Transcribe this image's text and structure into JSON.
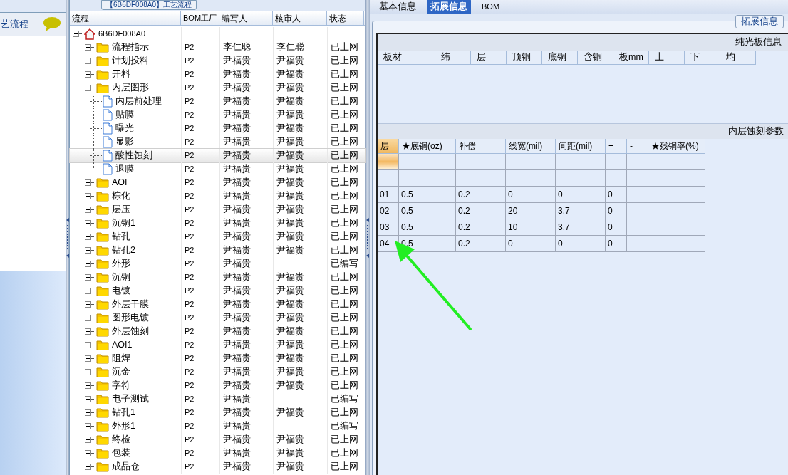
{
  "sidebar": {
    "title": "艺流程"
  },
  "process_panel": {
    "title": "【6B6DF008A0】工艺流程",
    "columns": [
      "流程",
      "BOM工厂",
      "编写人",
      "核审人",
      "状态"
    ],
    "tree": {
      "label": "6B6DF008A0",
      "kind": "root",
      "expanded": true,
      "selected": false,
      "children": [
        {
          "label": "流程指示",
          "kind": "folder",
          "expanded": false,
          "selected": false,
          "factory": "P2",
          "writer": "李仁聪",
          "reviewer": "李仁聪",
          "status": "已上网"
        },
        {
          "label": "计划投料",
          "kind": "folder",
          "expanded": false,
          "selected": false,
          "factory": "P2",
          "writer": "尹福贵",
          "reviewer": "尹福贵",
          "status": "已上网"
        },
        {
          "label": "开料",
          "kind": "folder",
          "expanded": false,
          "selected": false,
          "factory": "P2",
          "writer": "尹福贵",
          "reviewer": "尹福贵",
          "status": "已上网"
        },
        {
          "label": "内层图形",
          "kind": "folder",
          "expanded": true,
          "selected": false,
          "factory": "P2",
          "writer": "尹福贵",
          "reviewer": "尹福贵",
          "status": "已上网",
          "children": [
            {
              "label": "内层前处理",
              "kind": "document",
              "selected": false,
              "factory": "P2",
              "writer": "尹福贵",
              "reviewer": "尹福贵",
              "status": "已上网"
            },
            {
              "label": "贴膜",
              "kind": "document",
              "selected": false,
              "factory": "P2",
              "writer": "尹福贵",
              "reviewer": "尹福贵",
              "status": "已上网"
            },
            {
              "label": "曝光",
              "kind": "document",
              "selected": false,
              "factory": "P2",
              "writer": "尹福贵",
              "reviewer": "尹福贵",
              "status": "已上网"
            },
            {
              "label": "显影",
              "kind": "document",
              "selected": false,
              "factory": "P2",
              "writer": "尹福贵",
              "reviewer": "尹福贵",
              "status": "已上网"
            },
            {
              "label": "酸性蚀刻",
              "kind": "document",
              "selected": true,
              "factory": "P2",
              "writer": "尹福贵",
              "reviewer": "尹福贵",
              "status": "已上网"
            },
            {
              "label": "退膜",
              "kind": "document",
              "selected": false,
              "factory": "P2",
              "writer": "尹福贵",
              "reviewer": "尹福贵",
              "status": "已上网"
            }
          ]
        },
        {
          "label": "AOI",
          "kind": "folder",
          "expanded": false,
          "selected": false,
          "factory": "P2",
          "writer": "尹福贵",
          "reviewer": "尹福贵",
          "status": "已上网"
        },
        {
          "label": "棕化",
          "kind": "folder",
          "expanded": false,
          "selected": false,
          "factory": "P2",
          "writer": "尹福贵",
          "reviewer": "尹福贵",
          "status": "已上网"
        },
        {
          "label": "层压",
          "kind": "folder",
          "expanded": false,
          "selected": false,
          "factory": "P2",
          "writer": "尹福贵",
          "reviewer": "尹福贵",
          "status": "已上网"
        },
        {
          "label": "沉铜1",
          "kind": "folder",
          "expanded": false,
          "selected": false,
          "factory": "P2",
          "writer": "尹福贵",
          "reviewer": "尹福贵",
          "status": "已上网"
        },
        {
          "label": "钻孔",
          "kind": "folder",
          "expanded": false,
          "selected": false,
          "factory": "P2",
          "writer": "尹福贵",
          "reviewer": "尹福贵",
          "status": "已上网"
        },
        {
          "label": "钻孔2",
          "kind": "folder",
          "expanded": false,
          "selected": false,
          "factory": "P2",
          "writer": "尹福贵",
          "reviewer": "尹福贵",
          "status": "已上网"
        },
        {
          "label": "外形",
          "kind": "folder",
          "expanded": false,
          "selected": false,
          "factory": "P2",
          "writer": "尹福贵",
          "status": "已编写"
        },
        {
          "label": "沉铜",
          "kind": "folder",
          "expanded": false,
          "selected": false,
          "factory": "P2",
          "writer": "尹福贵",
          "reviewer": "尹福贵",
          "status": "已上网"
        },
        {
          "label": "电镀",
          "kind": "folder",
          "expanded": false,
          "selected": false,
          "factory": "P2",
          "writer": "尹福贵",
          "reviewer": "尹福贵",
          "status": "已上网"
        },
        {
          "label": "外层干膜",
          "kind": "folder",
          "expanded": false,
          "selected": false,
          "factory": "P2",
          "writer": "尹福贵",
          "reviewer": "尹福贵",
          "status": "已上网"
        },
        {
          "label": "图形电镀",
          "kind": "folder",
          "expanded": false,
          "selected": false,
          "factory": "P2",
          "writer": "尹福贵",
          "reviewer": "尹福贵",
          "status": "已上网"
        },
        {
          "label": "外层蚀刻",
          "kind": "folder",
          "expanded": false,
          "selected": false,
          "factory": "P2",
          "writer": "尹福贵",
          "reviewer": "尹福贵",
          "status": "已上网"
        },
        {
          "label": "AOI1",
          "kind": "folder",
          "expanded": false,
          "selected": false,
          "factory": "P2",
          "writer": "尹福贵",
          "reviewer": "尹福贵",
          "status": "已上网"
        },
        {
          "label": "阻焊",
          "kind": "folder",
          "expanded": false,
          "selected": false,
          "factory": "P2",
          "writer": "尹福贵",
          "reviewer": "尹福贵",
          "status": "已上网"
        },
        {
          "label": "沉金",
          "kind": "folder",
          "expanded": false,
          "selected": false,
          "factory": "P2",
          "writer": "尹福贵",
          "reviewer": "尹福贵",
          "status": "已上网"
        },
        {
          "label": "字符",
          "kind": "folder",
          "expanded": false,
          "selected": false,
          "factory": "P2",
          "writer": "尹福贵",
          "reviewer": "尹福贵",
          "status": "已上网"
        },
        {
          "label": "电子测试",
          "kind": "folder",
          "expanded": false,
          "selected": false,
          "factory": "P2",
          "writer": "尹福贵",
          "status": "已编写"
        },
        {
          "label": "钻孔1",
          "kind": "folder",
          "expanded": false,
          "selected": false,
          "factory": "P2",
          "writer": "尹福贵",
          "reviewer": "尹福贵",
          "status": "已上网"
        },
        {
          "label": "外形1",
          "kind": "folder",
          "expanded": false,
          "selected": false,
          "factory": "P2",
          "writer": "尹福贵",
          "status": "已编写"
        },
        {
          "label": "终检",
          "kind": "folder",
          "expanded": false,
          "selected": false,
          "factory": "P2",
          "writer": "尹福贵",
          "reviewer": "尹福贵",
          "status": "已上网"
        },
        {
          "label": "包装",
          "kind": "folder",
          "expanded": false,
          "selected": false,
          "factory": "P2",
          "writer": "尹福贵",
          "reviewer": "尹福贵",
          "status": "已上网"
        },
        {
          "label": "成品仓",
          "kind": "folder",
          "expanded": false,
          "selected": false,
          "factory": "P2",
          "writer": "尹福贵",
          "reviewer": "尹福贵",
          "status": "已上网"
        }
      ]
    }
  },
  "detail_panel": {
    "tabs": [
      {
        "label": "基本信息",
        "selected": false
      },
      {
        "label": "拓展信息",
        "selected": true
      },
      {
        "label": "BOM",
        "selected": false
      }
    ],
    "group_title": "拓展信息",
    "bare_board": {
      "title": "纯光板信息",
      "columns": [
        "板材",
        "纬",
        "层",
        "顶铜",
        "底铜",
        "含铜",
        "板mm",
        "上",
        "下",
        "均"
      ]
    },
    "inner_etch": {
      "title": "内层蚀刻参数",
      "columns": [
        "层",
        "★底铜(oz)",
        "补偿",
        "线宽(mil)",
        "间距(mil)",
        "+",
        "-",
        "★残铜率(%)"
      ],
      "rows": [
        {
          "selected": true
        },
        {
          "selected": false
        },
        {
          "selected": false,
          "cells": [
            "01",
            "0.5",
            "0.2",
            "0",
            "0",
            "0"
          ]
        },
        {
          "selected": false,
          "cells": [
            "02",
            "0.5",
            "0.2",
            "20",
            "3.7",
            "0"
          ]
        },
        {
          "selected": false,
          "cells": [
            "03",
            "0.5",
            "0.2",
            "10",
            "3.7",
            "0"
          ]
        },
        {
          "selected": false,
          "cells": [
            "04",
            "0.5",
            "0.2",
            "0",
            "0",
            "0"
          ]
        }
      ]
    }
  }
}
